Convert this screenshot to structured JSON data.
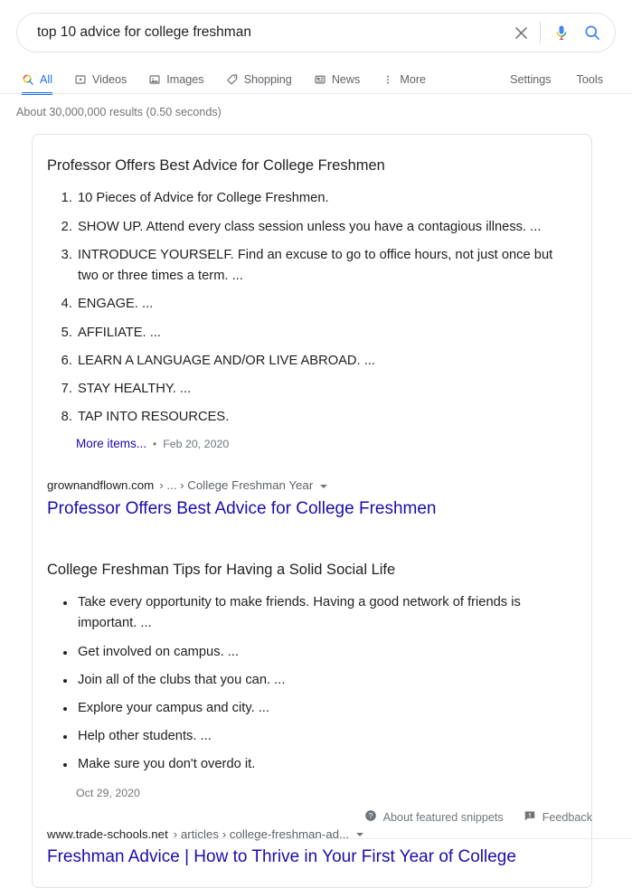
{
  "search": {
    "query": "top 10 advice for college freshman",
    "placeholder": "Search",
    "clear_icon": "close-icon",
    "mic_icon": "microphone-icon",
    "search_icon": "search-icon"
  },
  "nav": {
    "tabs": [
      {
        "label": "All",
        "icon": "search-icon",
        "active": true
      },
      {
        "label": "Videos",
        "icon": "video-icon",
        "active": false
      },
      {
        "label": "Images",
        "icon": "image-icon",
        "active": false
      },
      {
        "label": "Shopping",
        "icon": "tag-icon",
        "active": false
      },
      {
        "label": "News",
        "icon": "news-icon",
        "active": false
      },
      {
        "label": "More",
        "icon": "more-vertical-icon",
        "active": false
      }
    ],
    "right": [
      {
        "label": "Settings"
      },
      {
        "label": "Tools"
      }
    ]
  },
  "result_stats": "About 30,000,000 results (0.50 seconds)",
  "snippets": [
    {
      "title": "Professor Offers Best Advice for College Freshmen",
      "list_type": "ordered",
      "items": [
        "10 Pieces of Advice for College Freshmen.",
        "SHOW UP. Attend every class session unless you have a contagious illness. ...",
        "INTRODUCE YOURSELF. Find an excuse to go to office hours, not just once but two or three times a term. ...",
        "ENGAGE. ...",
        "AFFILIATE. ...",
        "LEARN A LANGUAGE AND/OR LIVE ABROAD. ...",
        "STAY HEALTHY. ...",
        "TAP INTO RESOURCES."
      ],
      "more_items_label": "More items...",
      "separator": "•",
      "date": "Feb 20, 2020",
      "source_domain": "grownandflown.com",
      "source_crumbs": "› ... › College Freshman Year",
      "result_title": "Professor Offers Best Advice for College Freshmen"
    },
    {
      "title": "College Freshman Tips for Having a Solid Social Life",
      "list_type": "unordered",
      "items": [
        "Take every opportunity to make friends. Having a good network of friends is important. ...",
        "Get involved on campus. ...",
        "Join all of the clubs that you can. ...",
        "Explore your campus and city. ...",
        "Help other students. ...",
        "Make sure you don't overdo it."
      ],
      "date": "Oct 29, 2020",
      "source_domain": "www.trade-schools.net",
      "source_crumbs": "› articles › college-freshman-ad...",
      "result_title": "Freshman Advice | How to Thrive in Your First Year of College"
    }
  ],
  "footer": {
    "about_label": "About featured snippets",
    "about_icon": "help-circle-icon",
    "feedback_label": "Feedback",
    "feedback_icon": "feedback-icon"
  },
  "colors": {
    "link": "#1a0dab",
    "accent": "#1a73e8",
    "muted": "#70757a",
    "border": "#dfe1e5"
  }
}
